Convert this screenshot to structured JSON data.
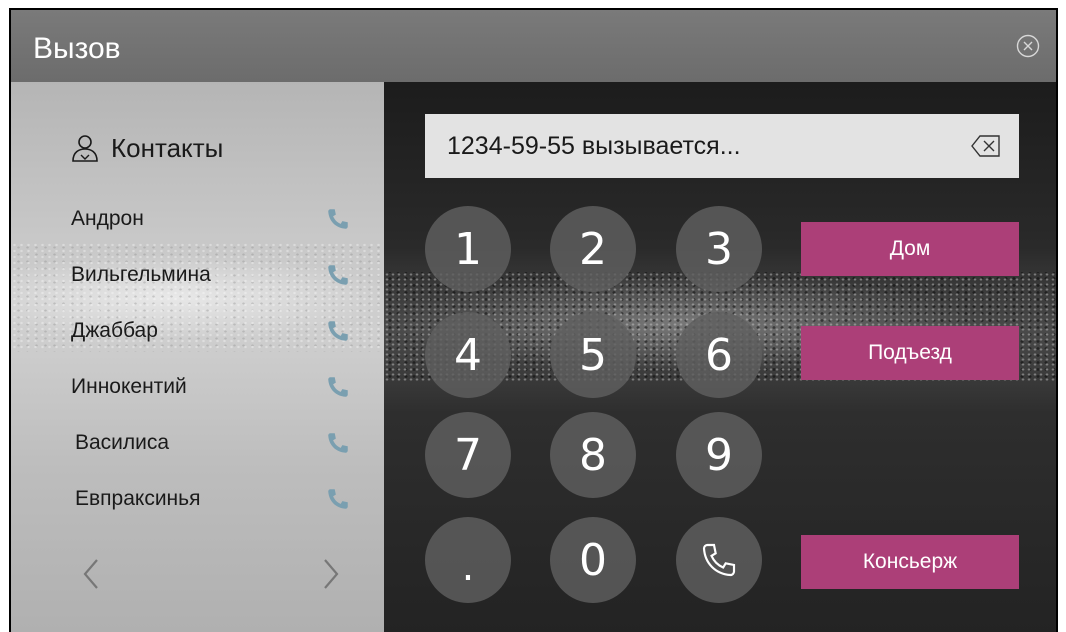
{
  "window": {
    "title": "Вызов"
  },
  "contacts": {
    "header": "Контакты",
    "items": [
      {
        "name": "Андрон"
      },
      {
        "name": "Вильгельмина"
      },
      {
        "name": "Джаббар"
      },
      {
        "name": "Иннокентий"
      },
      {
        "name": "Василиса"
      },
      {
        "name": "Евпраксинья"
      }
    ]
  },
  "dialer": {
    "display_text": "1234-59-55 вызывается...",
    "keys": [
      "1",
      "2",
      "3",
      "4",
      "5",
      "6",
      "7",
      "8",
      "9",
      ".",
      "0"
    ]
  },
  "quick_buttons": {
    "home": "Дом",
    "entrance": "Подъезд",
    "concierge": "Консьерж"
  },
  "colors": {
    "accent": "#ac3f78",
    "phone_icon": "#7a9fb0"
  }
}
